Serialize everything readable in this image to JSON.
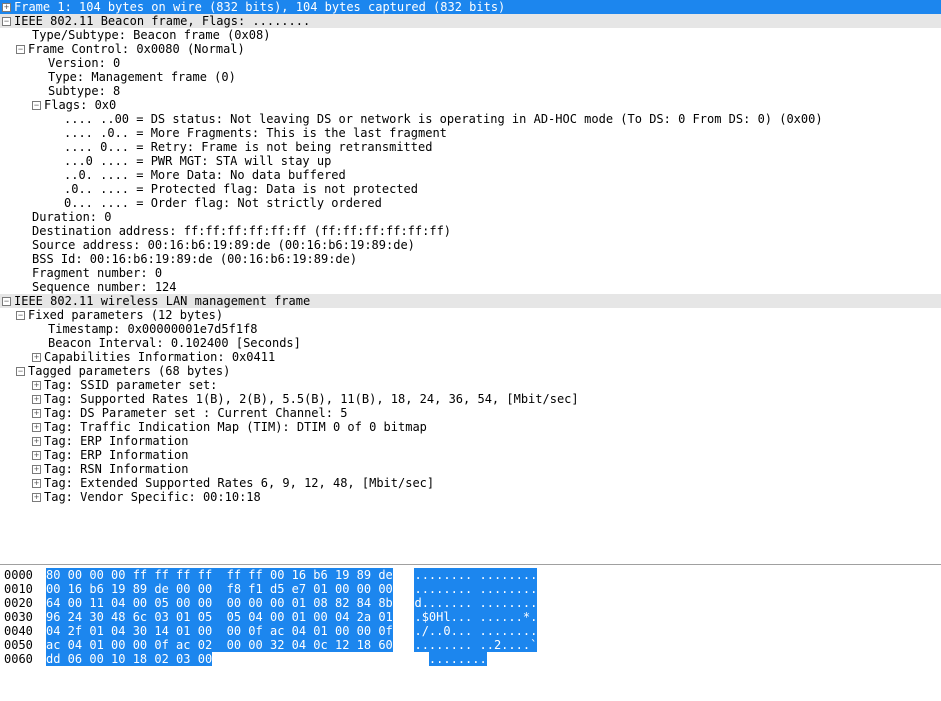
{
  "frame_header": "Frame 1: 104 bytes on wire (832 bits), 104 bytes captured (832 bits)",
  "beacon": {
    "title": "IEEE 802.11 Beacon frame, Flags: ........",
    "subtype": "Type/Subtype: Beacon frame (0x08)",
    "framectrl": "Frame Control: 0x0080 (Normal)",
    "version": "Version: 0",
    "type": "Type: Management frame (0)",
    "subtype_n": "Subtype: 8",
    "flags_hdr": "Flags: 0x0",
    "flag_ds": ".... ..00 = DS status: Not leaving DS or network is operating in AD-HOC mode (To DS: 0 From DS: 0) (0x00)",
    "flag_frag": ".... .0.. = More Fragments: This is the last fragment",
    "flag_retry": ".... 0... = Retry: Frame is not being retransmitted",
    "flag_pwr": "...0 .... = PWR MGT: STA will stay up",
    "flag_more": "..0. .... = More Data: No data buffered",
    "flag_prot": ".0.. .... = Protected flag: Data is not protected",
    "flag_ord": "0... .... = Order flag: Not strictly ordered",
    "duration": "Duration: 0",
    "dst": "Destination address: ff:ff:ff:ff:ff:ff (ff:ff:ff:ff:ff:ff)",
    "src": "Source address: 00:16:b6:19:89:de (00:16:b6:19:89:de)",
    "bss": "BSS Id: 00:16:b6:19:89:de (00:16:b6:19:89:de)",
    "frag": "Fragment number: 0",
    "seq": "Sequence number: 124"
  },
  "mgmt": {
    "title": "IEEE 802.11 wireless LAN management frame",
    "fixed_hdr": "Fixed parameters (12 bytes)",
    "timestamp": "Timestamp: 0x00000001e7d5f1f8",
    "interval": "Beacon Interval: 0.102400 [Seconds]",
    "caps": "Capabilities Information: 0x0411",
    "tagged_hdr": "Tagged parameters (68 bytes)",
    "tag_ssid": "Tag: SSID parameter set:",
    "tag_rates": "Tag: Supported Rates 1(B), 2(B), 5.5(B), 11(B), 18, 24, 36, 54, [Mbit/sec]",
    "tag_ds": "Tag: DS Parameter set : Current Channel: 5",
    "tag_tim": "Tag: Traffic Indication Map (TIM): DTIM 0 of 0 bitmap",
    "tag_erp1": "Tag: ERP Information",
    "tag_erp2": "Tag: ERP Information",
    "tag_rsn": "Tag: RSN Information",
    "tag_ext": "Tag: Extended Supported Rates 6, 9, 12, 48, [Mbit/sec]",
    "tag_vendor": "Tag: Vendor Specific: 00:10:18"
  },
  "hex": [
    {
      "off": "0000",
      "b": "80 00 00 00 ff ff ff ff  ff ff 00 16 b6 19 89 de",
      "a": "........ ........"
    },
    {
      "off": "0010",
      "b": "00 16 b6 19 89 de 00 00  f8 f1 d5 e7 01 00 00 00",
      "a": "........ ........"
    },
    {
      "off": "0020",
      "b": "64 00 11 04 00 05 00 00  00 00 00 01 08 82 84 8b",
      "a": "d....... ........"
    },
    {
      "off": "0030",
      "b": "96 24 30 48 6c 03 01 05  05 04 00 01 00 04 2a 01",
      "a": ".$0Hl... ......*."
    },
    {
      "off": "0040",
      "b": "04 2f 01 04 30 14 01 00  00 0f ac 04 01 00 00 0f",
      "a": "./..0... ........"
    },
    {
      "off": "0050",
      "b": "ac 04 01 00 00 0f ac 02  00 00 32 04 0c 12 18 60",
      "a": "........ ..2....`"
    },
    {
      "off": "0060",
      "b": "dd 06 00 10 18 02 03 00",
      "a": "........"
    }
  ]
}
